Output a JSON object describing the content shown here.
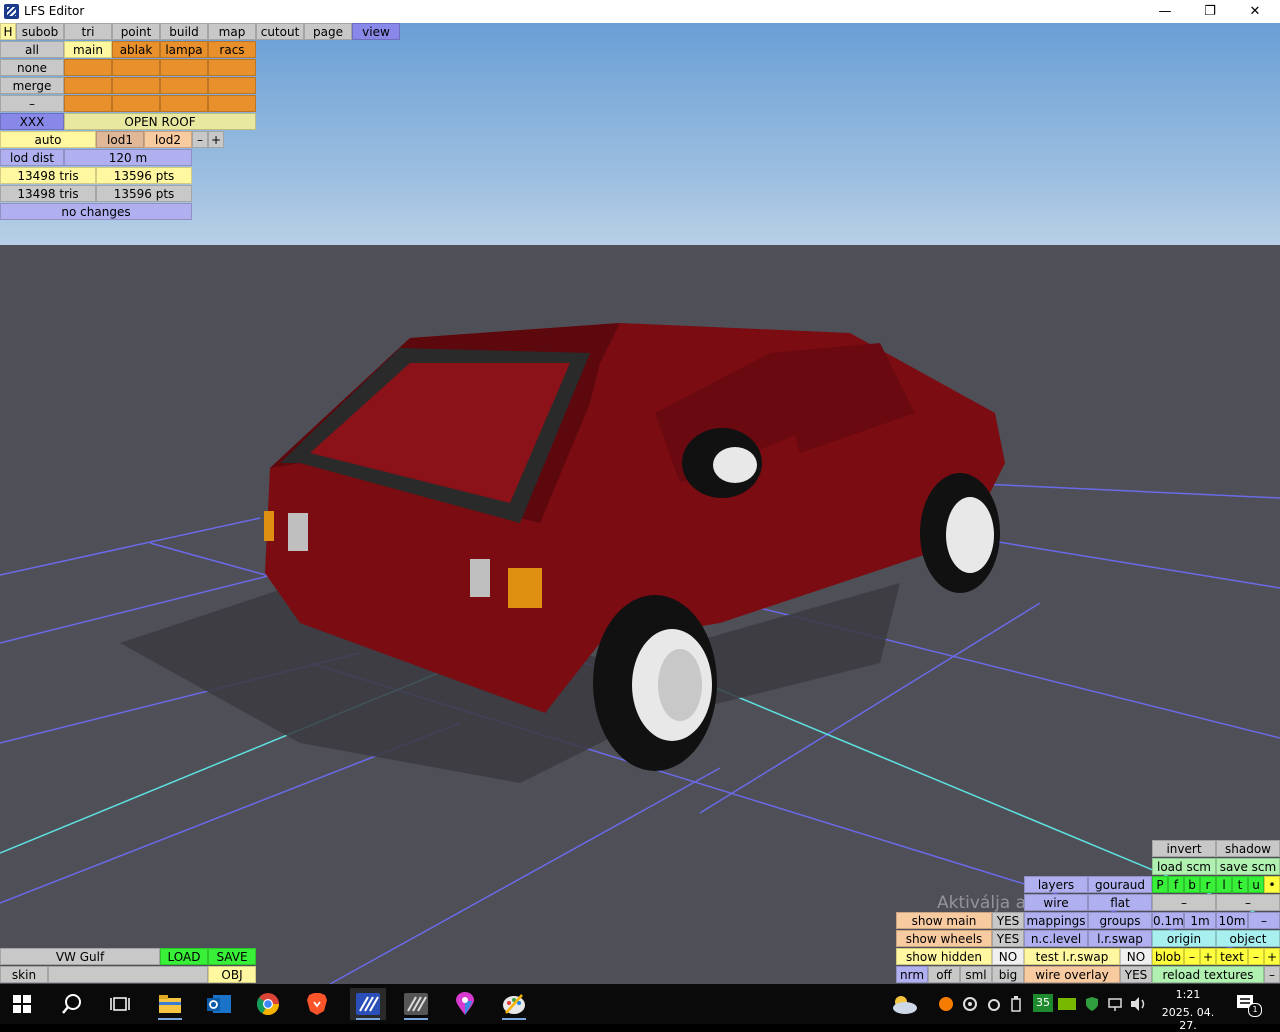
{
  "window": {
    "title": "LFS Editor",
    "minimize": "—",
    "restore": "❐",
    "close": "✕"
  },
  "top_tabs": [
    "H",
    "subob",
    "tri",
    "point",
    "build",
    "map",
    "cutout",
    "page",
    "view"
  ],
  "left_panel": {
    "all": "all",
    "none": "none",
    "merge": "merge",
    "dash": "–",
    "subobjects": [
      "main",
      "ablak",
      "lampa",
      "racs"
    ],
    "xxx": "XXX",
    "open_roof": "OPEN ROOF",
    "auto": "auto",
    "lod1": "lod1",
    "lod2": "lod2",
    "lod_minus": "–",
    "lod_plus": "+",
    "lod_dist_label": "lod dist",
    "lod_dist_value": "120 m",
    "tris1": "13498 tris",
    "pts1": "13596 pts",
    "tris2": "13498 tris",
    "pts2": "13596 pts",
    "no_changes": "no changes"
  },
  "bottom_left": {
    "model_name": "VW Gulf",
    "load": "LOAD",
    "save": "SAVE",
    "skin": "skin",
    "obj": "OBJ"
  },
  "bottom_right": {
    "invert": "invert",
    "shadow": "shadow",
    "load_scm": "load scm",
    "save_scm": "save scm",
    "view_letters": [
      "P",
      "f",
      "b",
      "r",
      "l",
      "t",
      "u",
      "•"
    ],
    "layers": "layers",
    "gouraud": "gouraud",
    "wire": "wire",
    "flat": "flat",
    "dash1": "–",
    "dash2": "–",
    "show_main": "show main",
    "show_main_val": "YES",
    "mappings": "mappings",
    "groups": "groups",
    "step1": "0.1m",
    "step2": "1m",
    "step3": "10m",
    "step_minus": "–",
    "show_wheels": "show wheels",
    "show_wheels_val": "YES",
    "nc_level": "n.c.level",
    "lr_swap": "l.r.swap",
    "origin": "origin",
    "object": "object",
    "show_hidden": "show hidden",
    "show_hidden_val": "NO",
    "test_lr_swap": "test l.r.swap",
    "test_lr_swap_val": "NO",
    "blob": "blob",
    "blob_minus": "–",
    "blob_plus": "+",
    "text": "text",
    "text_minus": "–",
    "text_plus": "+",
    "nrm": "nrm",
    "off": "off",
    "sml": "sml",
    "big": "big",
    "wire_overlay": "wire overlay",
    "wire_overlay_val": "YES",
    "reload_textures": "reload textures",
    "end_dash": "–"
  },
  "watermark": "Aktiválja a Windowst",
  "taskbar": {
    "time": "1:21",
    "date": "2025. 04. 27.",
    "badge": "35",
    "notif_count": "1",
    "apps": [
      "windows-start",
      "search",
      "task-view",
      "file-explorer",
      "outlook",
      "chrome",
      "brave",
      "lfs-editor",
      "lfs",
      "maps",
      "paint"
    ]
  },
  "colors": {
    "sky_top": "#6a9fd6",
    "floor": "#4f4f57",
    "car_body": "#7a0c12",
    "grid_line": "#6a6ae8",
    "axis_line": "#5ee0e0"
  }
}
